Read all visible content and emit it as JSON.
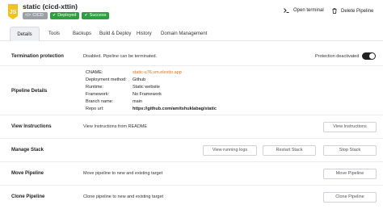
{
  "header": {
    "title": "static (cicd-xttin)",
    "badges": {
      "cicd": "CICD",
      "deployed": "Deployed",
      "success": "Success"
    },
    "actions": {
      "open_terminal": "Open terminal",
      "delete_pipeline": "Delete Pipeline"
    }
  },
  "tabs": {
    "details": "Details",
    "tools": "Tools",
    "backups": "Backups",
    "build_deploy": "Build & Deploy",
    "history": "History",
    "domain_management": "Domain Management"
  },
  "termination": {
    "label": "Termination protection",
    "description": "Disabled. Pipeline can be terminated.",
    "toggle_label": "Protection deactivated"
  },
  "pipeline_details": {
    "label": "Pipeline Details",
    "rows": [
      {
        "key": "CNAME:",
        "value": "static-u76.vm.elestio.app"
      },
      {
        "key": "Deployment method:",
        "value": "Github"
      },
      {
        "key": "Runtime:",
        "value": "Static website"
      },
      {
        "key": "Framework:",
        "value": "No Framework"
      },
      {
        "key": "Branch name:",
        "value": "main"
      },
      {
        "key": "Repo url:",
        "value": "https://github.com/amitshuklabag/static"
      }
    ]
  },
  "view_instructions": {
    "label": "View Instructions",
    "description": "View Instructions from README",
    "button": "View Instructions"
  },
  "manage_stack": {
    "label": "Manage Stack",
    "buttons": {
      "view_logs": "View running logs",
      "restart": "Restart Stack",
      "stop": "Stop Stack"
    }
  },
  "move_pipeline": {
    "label": "Move Pipeline",
    "description": "Move pipeline to new and existing target",
    "button": "Move Pipeline"
  },
  "clone_pipeline": {
    "label": "Clone Pipeline",
    "description": "Clone pipeline to new and existing target",
    "button": "Clone Pipeline"
  },
  "colors": {
    "accent_link": "#e0731f",
    "badge_green": "#2e9e3f",
    "badge_grey": "#9aa0a6",
    "logo_yellow": "#f0c419"
  },
  "icons": {
    "app_logo": "js-logo",
    "terminal": "terminal-icon",
    "delete": "trash-icon"
  }
}
